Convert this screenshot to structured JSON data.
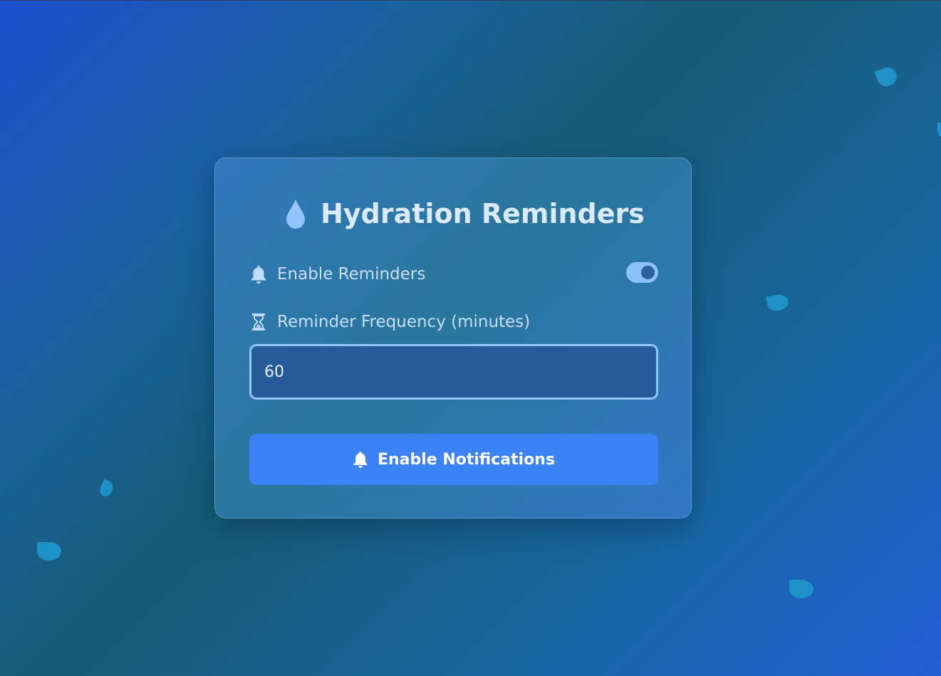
{
  "app": {
    "title": "Hydration Reminders",
    "title_icon": "water-drop-icon"
  },
  "settings": {
    "enable_label": "Enable Reminders",
    "enable_icon": "bell-icon",
    "enabled": true,
    "frequency_label": "Reminder Frequency (minutes)",
    "frequency_icon": "hourglass-icon",
    "frequency_value": "60"
  },
  "actions": {
    "notify_label": "Enable Notifications",
    "notify_icon": "bell-icon"
  },
  "colors": {
    "accent": "#3b82f6",
    "toggle_on": "#8cc0fb",
    "drop": "#1f93c9",
    "text": "#dbeafe"
  }
}
